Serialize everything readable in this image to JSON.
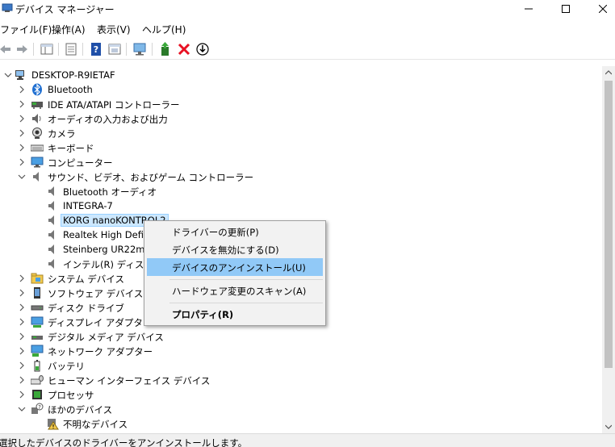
{
  "window": {
    "title": "デバイス マネージャー",
    "controls": {
      "minimize_icon": "minimize-icon",
      "maximize_icon": "maximize-icon",
      "close_icon": "close-icon"
    }
  },
  "menubar": {
    "items": [
      {
        "label": "ファイル(F)"
      },
      {
        "label": "操作(A)"
      },
      {
        "label": "表示(V)"
      },
      {
        "label": "ヘルプ(H)"
      }
    ]
  },
  "toolbar": {
    "buttons": [
      "back-icon",
      "forward-icon",
      "show-hide-tree-icon",
      "properties-icon",
      "help-icon",
      "action-pane-icon",
      "scan-hardware-icon",
      "update-driver-icon",
      "uninstall-icon",
      "disable-device-icon"
    ]
  },
  "tree": {
    "root": "DESKTOP-R9IETAF",
    "categories": {
      "bluetooth": "Bluetooth",
      "ide": "IDE ATA/ATAPI コントローラー",
      "audio_io": "オーディオの入力および出力",
      "camera": "カメラ",
      "keyboard": "キーボード",
      "computer": "コンピューター",
      "sound": "サウンド、ビデオ、およびゲーム コントローラー",
      "system": "システム デバイス",
      "software": "ソフトウェア デバイス",
      "disk": "ディスク ドライブ",
      "display": "ディスプレイ アダプター",
      "digital_media": "デジタル メディア デバイス",
      "network": "ネットワーク アダプター",
      "battery": "バッテリ",
      "hid": "ヒューマン インターフェイス デバイス",
      "processor": "プロセッサ",
      "other": "ほかのデバイス"
    },
    "sound_children": [
      "Bluetooth オーディオ",
      "INTEGRA-7",
      "KORG nanoKONTROL2",
      "Realtek High Defini",
      "Steinberg UR22mkI",
      "インテル(R) ディスプレ"
    ],
    "other_children": [
      "不明なデバイス"
    ]
  },
  "context_menu": {
    "items": [
      {
        "label": "ドライバーの更新(P)"
      },
      {
        "label": "デバイスを無効にする(D)"
      },
      {
        "label": "デバイスのアンインストール(U)",
        "highlighted": true
      },
      {
        "label": "ハードウェア変更のスキャン(A)"
      },
      {
        "label": "プロパティ(R)",
        "bold": true
      }
    ]
  },
  "status": {
    "text": "選択したデバイスのドライバーをアンインストールします。"
  },
  "colors": {
    "highlight": "#91c9f7",
    "selection": "#cce8ff",
    "delete_red": "#e81123"
  }
}
